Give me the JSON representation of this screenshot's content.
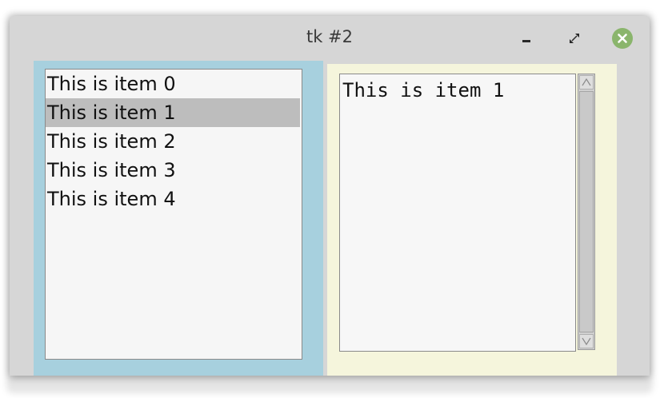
{
  "window": {
    "title": "tk #2",
    "controls": {
      "minimize_icon": "minimize-icon",
      "maximize_icon": "maximize-icon",
      "close_icon": "close-icon",
      "close_color": "#8ab56c"
    }
  },
  "left_panel": {
    "background": "#a7d0de",
    "listbox": {
      "items": [
        {
          "label": "This is item 0"
        },
        {
          "label": "This is item 1"
        },
        {
          "label": "This is item 2"
        },
        {
          "label": "This is item 3"
        },
        {
          "label": "This is item 4"
        }
      ],
      "selected_index": 1
    }
  },
  "right_panel": {
    "background": "#f5f5dc",
    "text_widget": {
      "content": "This is item 1"
    }
  }
}
